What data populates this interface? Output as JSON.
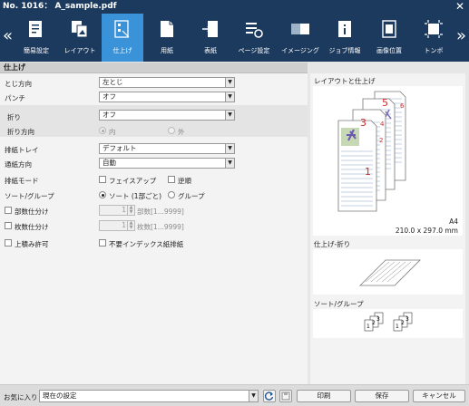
{
  "window": {
    "title": "No. 1016： A_sample.pdf",
    "close_glyph": "✕"
  },
  "toolbar": {
    "prev_glyph": "«",
    "next_glyph": "»",
    "tabs": [
      {
        "label": "簡易設定",
        "icon": "quick-setting-icon"
      },
      {
        "label": "レイアウト",
        "icon": "layout-icon"
      },
      {
        "label": "仕上げ",
        "icon": "finishing-icon",
        "active": true
      },
      {
        "label": "用紙",
        "icon": "paper-icon"
      },
      {
        "label": "表紙",
        "icon": "cover-icon"
      },
      {
        "label": "ページ設定",
        "icon": "page-setting-icon"
      },
      {
        "label": "イメージング",
        "icon": "imaging-icon"
      },
      {
        "label": "ジョブ情報",
        "icon": "job-info-icon"
      },
      {
        "label": "画像位置",
        "icon": "image-position-icon"
      },
      {
        "label": "トンボ",
        "icon": "crop-marks-icon"
      }
    ]
  },
  "section": {
    "title": "仕上げ"
  },
  "form": {
    "binding": {
      "label": "とじ方向",
      "value": "左とじ"
    },
    "punch": {
      "label": "パンチ",
      "value": "オフ"
    },
    "fold": {
      "label": "折り",
      "value": "オフ"
    },
    "fold_direction": {
      "label": "折り方向",
      "opt_in": "内",
      "opt_out": "外"
    },
    "output_tray": {
      "label": "排紙トレイ",
      "value": "デフォルト"
    },
    "paper_path": {
      "label": "通紙方向",
      "value": "自動"
    },
    "output_mode": {
      "label": "排紙モード",
      "face_up": "フェイスアップ",
      "reverse": "逆順"
    },
    "sort_group": {
      "label": "ソート/グループ",
      "sort": "ソート (1部ごと)",
      "group": "グループ"
    },
    "copy_separation": {
      "label": "部数仕分け",
      "value": "1",
      "hint": "部数[1...9999]"
    },
    "sheet_separation": {
      "label": "枚数仕分け",
      "value": "1",
      "hint": "枚数[1...9999]"
    },
    "offset_stack": {
      "label": "上積み許可"
    },
    "index_paper": {
      "label": "不要インデックス紙排紙"
    }
  },
  "preview": {
    "layout_title": "レイアウトと仕上げ",
    "paper_size": "A4",
    "paper_dim": "210.0 x 297.0 mm",
    "page_numbers": [
      "5",
      "6",
      "3",
      "4",
      "1",
      "2"
    ],
    "fold_title": "仕上げ-折り",
    "sort_title": "ソート/グループ",
    "sort_nums": [
      "1",
      "2",
      "3"
    ]
  },
  "footer": {
    "favorite_label": "お気に入り",
    "favorite_value": "現在の設定",
    "print_label": "印刷",
    "save_label": "保存",
    "cancel_label": "キャンセル"
  },
  "colors": {
    "title_bg": "#1c3a5e",
    "active_tab": "#3a92d8",
    "page_number": "#cc2a2a"
  }
}
